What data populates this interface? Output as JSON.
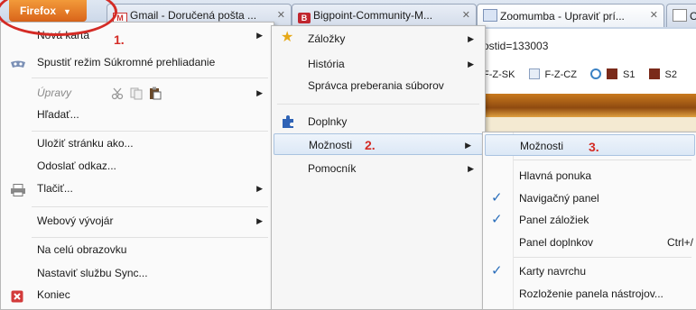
{
  "tabs": [
    {
      "label": "Gmail - Doručená pošta ...",
      "icon": "gmail-icon"
    },
    {
      "label": "Bigpoint-Community-M...",
      "icon": "bigpoint-icon"
    },
    {
      "label": "Zoomumba - Upraviť prí...",
      "icon": "page-icon"
    },
    {
      "label": "C",
      "icon": "page-icon"
    }
  ],
  "firefox_button": {
    "label": "Firefox"
  },
  "address_fragment": "ostid=133003",
  "bookmarks_fragment": [
    "F-Z-SK",
    "F-Z-CZ",
    "S1",
    "S2"
  ],
  "annotations": {
    "one": "1.",
    "two": "2.",
    "three": "3."
  },
  "menu_main": {
    "new_tab": "Nová karta",
    "private": "Spustiť režim Súkromné prehliadanie",
    "edit": "Úpravy",
    "find": "Hľadať...",
    "save_page": "Uložiť stránku ako...",
    "send_link": "Odoslať odkaz...",
    "print": "Tlačiť...",
    "web_dev": "Webový vývojár",
    "fullscreen": "Na celú obrazovku",
    "sync": "Nastaviť službu Sync...",
    "quit": "Koniec"
  },
  "menu_middle": {
    "bookmarks": "Záložky",
    "history": "História",
    "downloads": "Správca preberania súborov",
    "addons": "Doplnky",
    "options": "Možnosti",
    "help": "Pomocník"
  },
  "menu_options": {
    "options": "Možnosti",
    "menu_bar": "Hlavná ponuka",
    "nav_bar": "Navigačný panel",
    "bookmarks_bar": "Panel záložiek",
    "addon_bar": "Panel doplnkov",
    "addon_shortcut": "Ctrl+/",
    "tabs_on_top": "Karty navrchu",
    "customize": "Rozloženie panela nástrojov..."
  },
  "colors": {
    "accent_orange": "#e57b26",
    "annotation_red": "#d42b25",
    "check_blue": "#2a6ebb"
  }
}
